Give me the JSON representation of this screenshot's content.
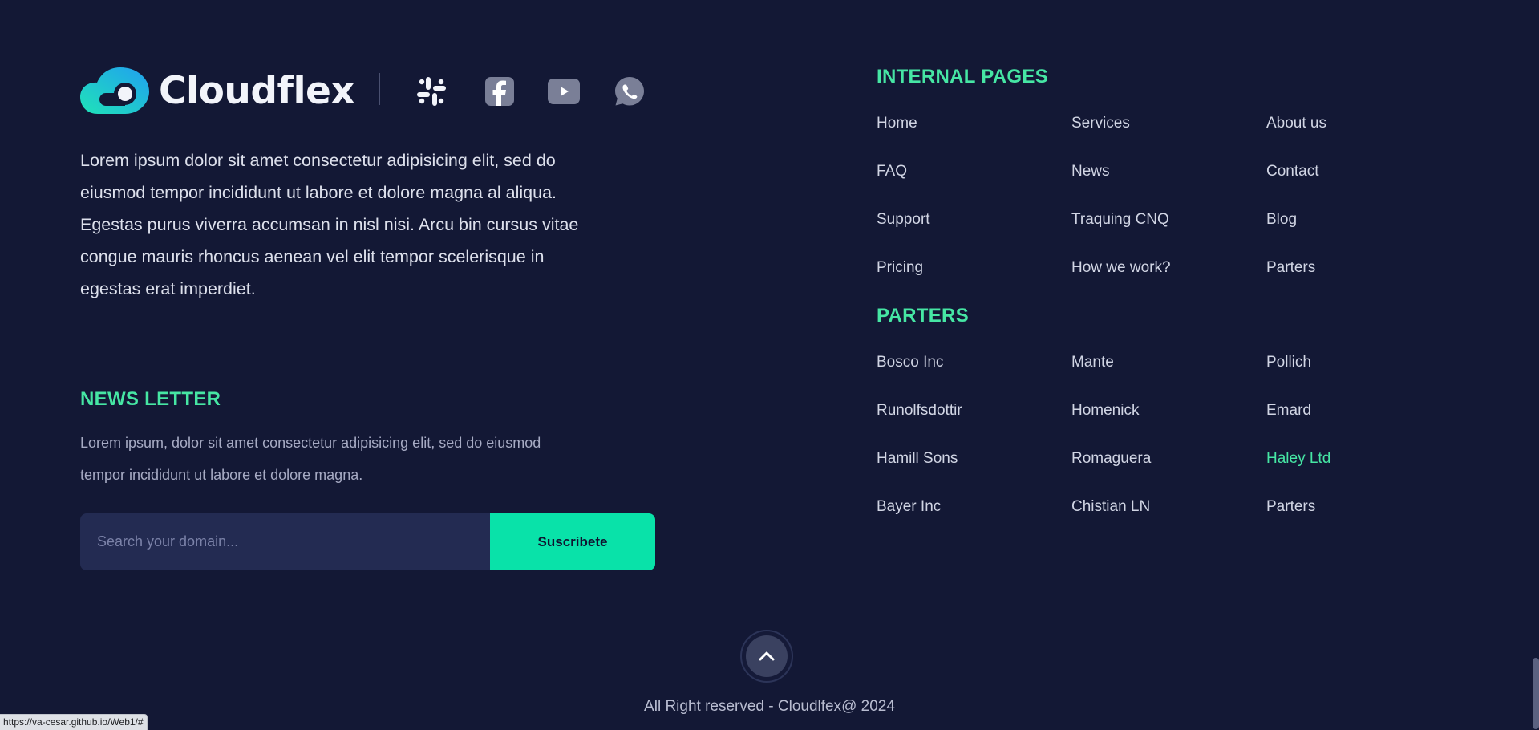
{
  "brand": {
    "name": "Cloudflex"
  },
  "social": [
    {
      "name": "slack-icon",
      "label": "Slack"
    },
    {
      "name": "facebook-icon",
      "label": "Facebook"
    },
    {
      "name": "youtube-icon",
      "label": "YouTube"
    },
    {
      "name": "whatsapp-icon",
      "label": "WhatsApp"
    }
  ],
  "about": {
    "text": "Lorem ipsum dolor sit amet consectetur adipisicing elit, sed do eiusmod tempor incididunt ut labore et dolore magna al aliqua. Egestas purus viverra accumsan in nisl nisi. Arcu bin cursus vitae congue mauris rhoncus aenean vel elit tempor scelerisque in egestas erat imperdiet."
  },
  "newsletter": {
    "title": "NEWS LETTER",
    "text": "Lorem ipsum, dolor sit amet consectetur adipisicing elit, sed do eiusmod tempor incididunt ut labore et dolore magna.",
    "placeholder": "Search your domain...",
    "button": "Suscribete"
  },
  "internal_pages": {
    "title": "INTERNAL PAGES",
    "links": [
      "Home",
      "Services",
      "About us",
      "FAQ",
      "News",
      "Contact",
      "Support",
      "Traquing CNQ",
      "Blog",
      "Pricing",
      "How we work?",
      "Parters"
    ]
  },
  "partners": {
    "title": "PARTERS",
    "links": [
      "Bosco Inc",
      "Mante",
      "Pollich",
      "Runolfsdottir",
      "Homenick",
      "Emard",
      "Hamill Sons",
      "Romaguera",
      "Haley Ltd",
      "Bayer Inc",
      "Chistian LN",
      "Parters"
    ],
    "highlighted": "Haley Ltd"
  },
  "footer": {
    "copyright": "All Right reserved - Cloudlfex@ 2024"
  },
  "status_url": "https://va-cesar.github.io/Web1/#",
  "colors": {
    "background": "#131835",
    "accent": "#46e6a4",
    "button": "#09e2a9",
    "input": "#232b52"
  }
}
